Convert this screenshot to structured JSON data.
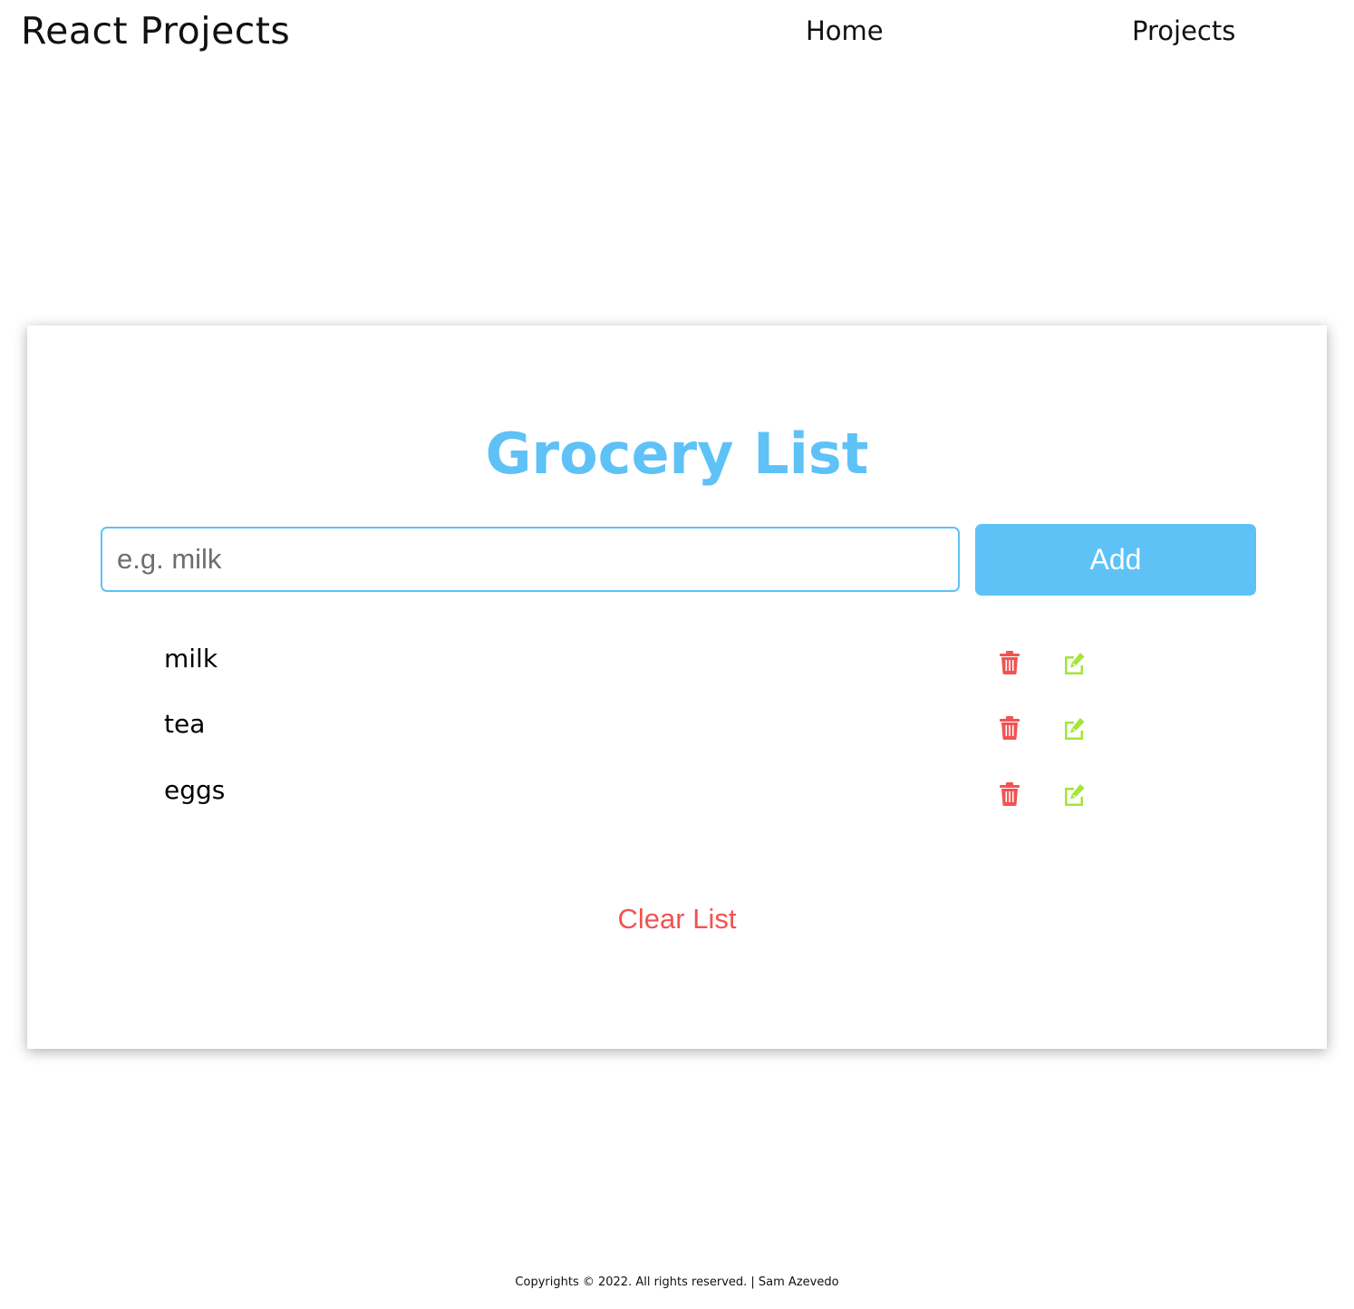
{
  "navbar": {
    "brand": "React Projects",
    "links": [
      "Home",
      "Projects"
    ]
  },
  "grocery": {
    "title": "Grocery List",
    "input": {
      "placeholder": "e.g. milk",
      "value": ""
    },
    "add_label": "Add",
    "items": [
      {
        "name": "milk"
      },
      {
        "name": "tea"
      },
      {
        "name": "eggs"
      }
    ],
    "item_actions": {
      "delete_icon": "trash-icon",
      "edit_icon": "edit-icon"
    },
    "clear_label": "Clear List"
  },
  "footer": {
    "text": "Copyrights © 2022. All rights reserved. | Sam Azevedo"
  },
  "colors": {
    "accent": "#5ec2f7",
    "danger": "#f35252",
    "success": "#a3e635",
    "text": "#111111",
    "background": "#ffffff"
  }
}
